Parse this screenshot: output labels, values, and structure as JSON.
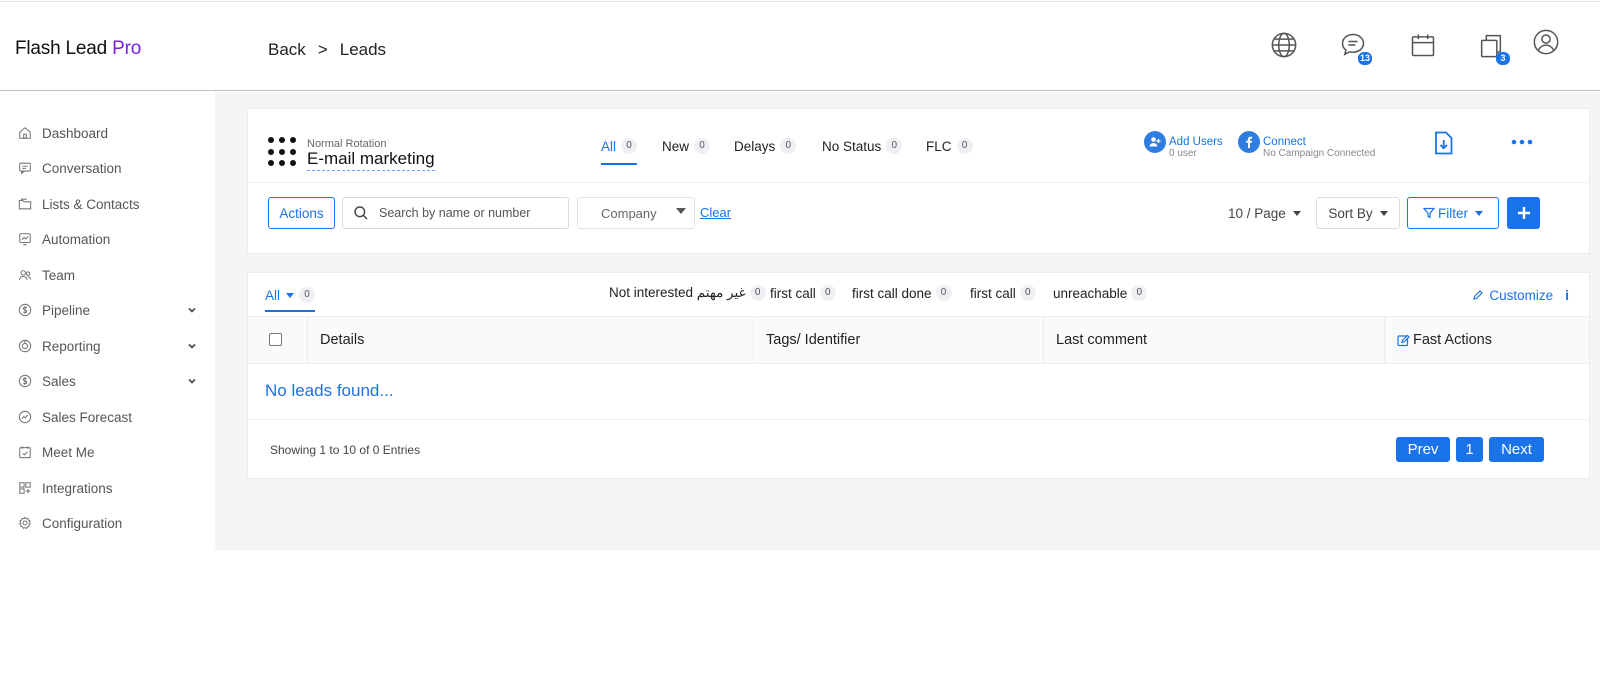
{
  "app": {
    "brand_main": "Flash Lead",
    "brand_pro": "Pro"
  },
  "breadcrumb": {
    "back": "Back",
    "separator": ">",
    "current": "Leads"
  },
  "top_icons": {
    "messages_badge": "13",
    "copies_badge": "3"
  },
  "sidebar": {
    "items": [
      {
        "label": "Dashboard",
        "icon": "home-icon"
      },
      {
        "label": "Conversation",
        "icon": "chat-icon"
      },
      {
        "label": "Lists & Contacts",
        "icon": "folder-icon"
      },
      {
        "label": "Automation",
        "icon": "automation-icon"
      },
      {
        "label": "Team",
        "icon": "team-icon"
      },
      {
        "label": "Pipeline",
        "icon": "dollar-icon",
        "expandable": true
      },
      {
        "label": "Reporting",
        "icon": "reporting-icon",
        "expandable": true
      },
      {
        "label": "Sales",
        "icon": "dollar-icon",
        "expandable": true
      },
      {
        "label": "Sales Forecast",
        "icon": "forecast-icon"
      },
      {
        "label": "Meet Me",
        "icon": "calendar-check-icon"
      },
      {
        "label": "Integrations",
        "icon": "integrations-icon"
      },
      {
        "label": "Configuration",
        "icon": "gear-icon"
      }
    ]
  },
  "campaign": {
    "rotation_label": "Normal Rotation",
    "name": "E-mail marketing"
  },
  "stage_tabs": [
    {
      "label": "All",
      "count": "0",
      "active": true
    },
    {
      "label": "New",
      "count": "0"
    },
    {
      "label": "Delays",
      "count": "0"
    },
    {
      "label": "No Status",
      "count": "0"
    },
    {
      "label": "FLC",
      "count": "0"
    }
  ],
  "add_users": {
    "label": "Add Users",
    "sub": "0 user"
  },
  "connect": {
    "label": "Connect",
    "sub": "No Campaign Connected"
  },
  "toolbar": {
    "actions_label": "Actions",
    "search_placeholder": "Search by name or number",
    "company_label": "Company",
    "clear_label": "Clear",
    "per_page_label": "10 / Page",
    "sort_label": "Sort By",
    "filter_label": "Filter"
  },
  "filter_tabs": {
    "all_label": "All",
    "all_count": "0",
    "statuses": [
      {
        "label": "Not interested غير مهتم",
        "count": "0"
      },
      {
        "label": "first call",
        "count": "0"
      },
      {
        "label": "first call done",
        "count": "0"
      },
      {
        "label": "first call",
        "count": "0"
      },
      {
        "label": "unreachable",
        "count": "0"
      }
    ],
    "customize_label": "Customize",
    "info_label": "i"
  },
  "table": {
    "columns": [
      "Details",
      "Tags/ Identifier",
      "Last comment",
      "Fast Actions"
    ],
    "empty_message": "No leads found..."
  },
  "pagination": {
    "showing": "Showing 1 to 10 of 0 Entries",
    "prev": "Prev",
    "page": "1",
    "next": "Next"
  },
  "colors": {
    "accent": "#1a73e8",
    "brand_pro": "#7b1fe0"
  }
}
